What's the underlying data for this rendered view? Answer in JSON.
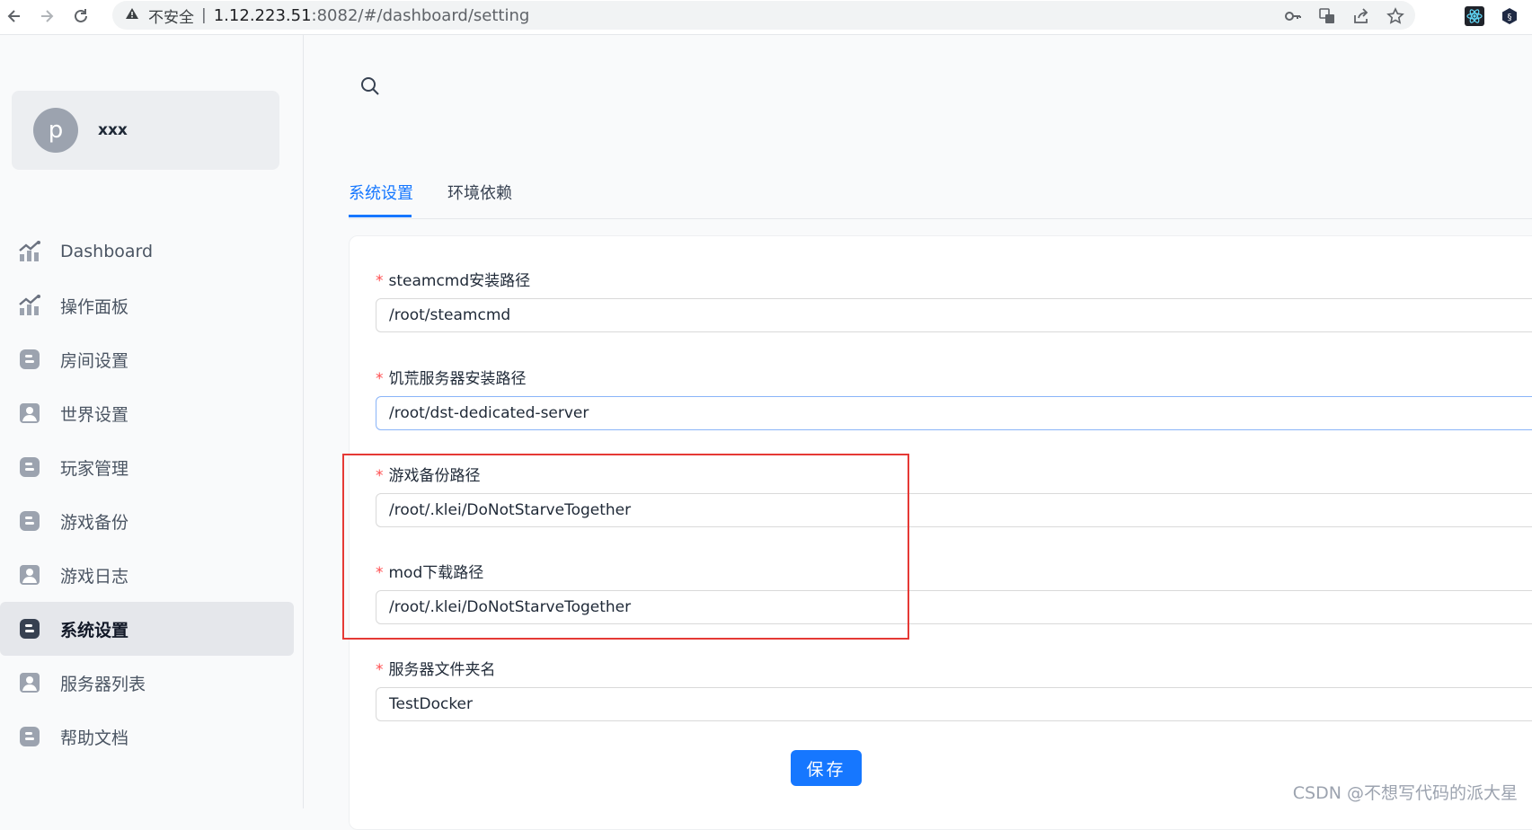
{
  "browser": {
    "insecure_label": "不安全",
    "separator": "|",
    "url_host": "1.12.223.51",
    "url_rest": ":8082/#/dashboard/setting"
  },
  "user": {
    "avatar_letter": "p",
    "name": "xxx"
  },
  "sidebar": {
    "items": [
      {
        "label": "Dashboard",
        "icon": "chart-icon"
      },
      {
        "label": "操作面板",
        "icon": "chart-icon"
      },
      {
        "label": "房间设置",
        "icon": "blog-icon"
      },
      {
        "label": "世界设置",
        "icon": "user-icon"
      },
      {
        "label": "玩家管理",
        "icon": "blog-icon"
      },
      {
        "label": "游戏备份",
        "icon": "blog-icon"
      },
      {
        "label": "游戏日志",
        "icon": "user-icon"
      },
      {
        "label": "系统设置",
        "icon": "blog-icon",
        "active": true
      },
      {
        "label": "服务器列表",
        "icon": "user-icon"
      },
      {
        "label": "帮助文档",
        "icon": "blog-icon"
      }
    ]
  },
  "tabs": [
    {
      "label": "系统设置",
      "active": true
    },
    {
      "label": "环境依赖"
    }
  ],
  "form": {
    "required_mark": "*",
    "fields": [
      {
        "label": "steamcmd安装路径",
        "value": "/root/steamcmd"
      },
      {
        "label": "饥荒服务器安装路径",
        "value": "/root/dst-dedicated-server"
      },
      {
        "label": "游戏备份路径",
        "value": "/root/.klei/DoNotStarveTogether"
      },
      {
        "label": "mod下载路径",
        "value": "/root/.klei/DoNotStarveTogether"
      },
      {
        "label": "服务器文件夹名",
        "value": "TestDocker"
      }
    ],
    "save_label": "保存"
  },
  "watermark": "CSDN @不想写代码的派大星",
  "colors": {
    "primary": "#1677ff",
    "required": "#ff4d4f",
    "highlight": "#e53935"
  }
}
